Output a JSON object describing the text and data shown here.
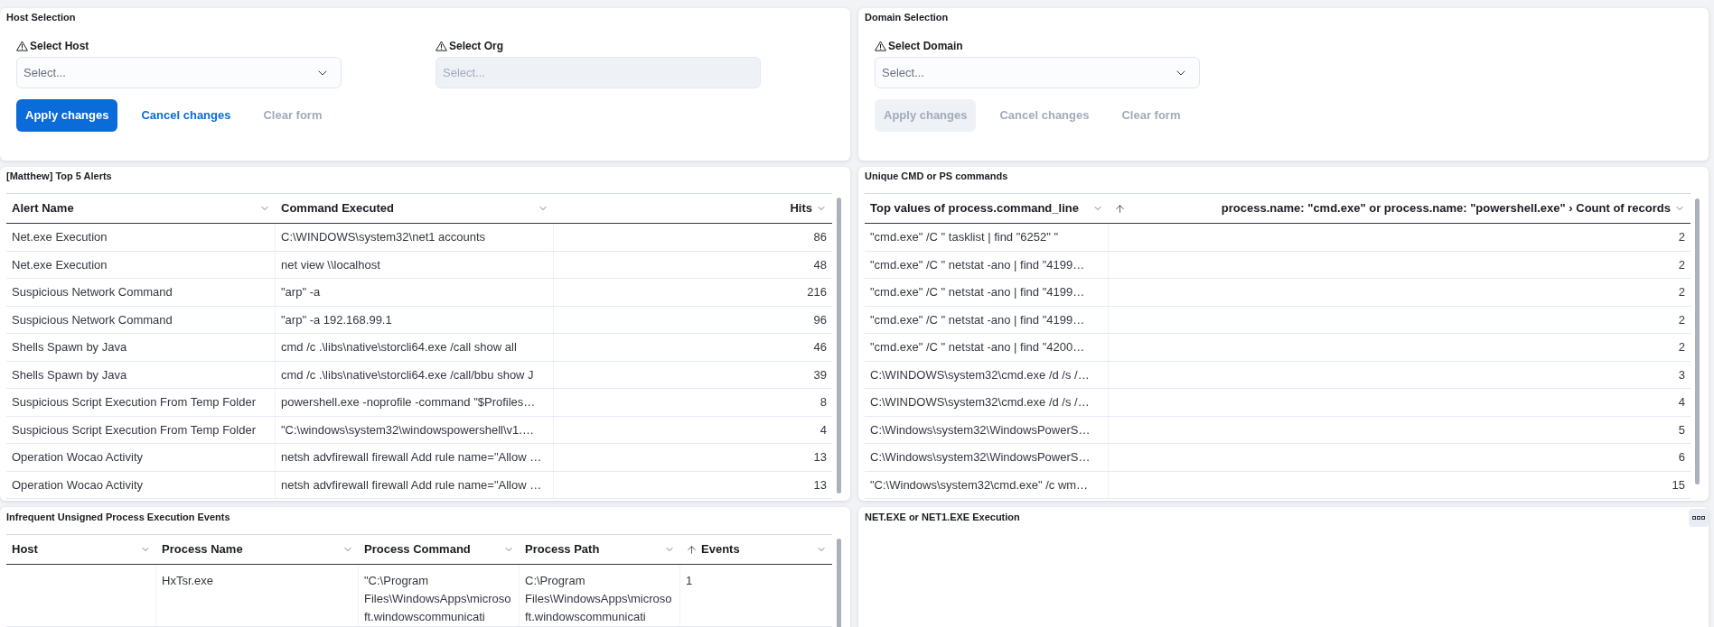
{
  "host_selection": {
    "title": "Host Selection",
    "fields": [
      {
        "label": "Select Host",
        "warning": true,
        "placeholder": "Select...",
        "disabled": false
      },
      {
        "label": "Select Org",
        "warning": true,
        "placeholder": "Select...",
        "disabled": true
      }
    ],
    "buttons": [
      {
        "label": "Apply changes",
        "kind": "fill",
        "disabled": false
      },
      {
        "label": "Cancel changes",
        "kind": "empty",
        "disabled": false
      },
      {
        "label": "Clear form",
        "kind": "empty",
        "disabled": true
      }
    ]
  },
  "domain_selection": {
    "title": "Domain Selection",
    "fields": [
      {
        "label": "Select Domain",
        "warning": true,
        "placeholder": "Select...",
        "disabled": false
      }
    ],
    "buttons": [
      {
        "label": "Apply changes",
        "kind": "fill",
        "disabled": true
      },
      {
        "label": "Cancel changes",
        "kind": "empty",
        "disabled": true
      },
      {
        "label": "Clear form",
        "kind": "empty",
        "disabled": true
      }
    ]
  },
  "top_alerts": {
    "title": "[Matthew] Top 5 Alerts",
    "columns": [
      {
        "label": "Alert Name",
        "sorted": false
      },
      {
        "label": "Command Executed",
        "sorted": false
      },
      {
        "label": "Hits",
        "sorted": false
      }
    ],
    "rows": [
      [
        "Net.exe Execution",
        "C:\\WINDOWS\\system32\\net1 accounts",
        "86"
      ],
      [
        "Net.exe Execution",
        "net view \\\\localhost",
        "48"
      ],
      [
        "Suspicious Network Command",
        "\"arp\" -a",
        "216"
      ],
      [
        "Suspicious Network Command",
        "\"arp\" -a 192.168.99.1",
        "96"
      ],
      [
        "Shells Spawn by Java",
        "cmd /c .\\libs\\native\\storcli64.exe /call show all",
        "46"
      ],
      [
        "Shells Spawn by Java",
        "cmd /c .\\libs\\native\\storcli64.exe /call/bbu show J",
        "39"
      ],
      [
        "Suspicious Script Execution From Temp Folder",
        "powershell.exe -noprofile -command \"$Profiles…",
        "8"
      ],
      [
        "Suspicious Script Execution From Temp Folder",
        "\"C:\\windows\\system32\\windowspowershell\\v1.…",
        "4"
      ],
      [
        "Operation Wocao Activity",
        "netsh advfirewall firewall Add rule name=\"Allow …",
        "13"
      ],
      [
        "Operation Wocao Activity",
        "netsh advfirewall firewall Add rule name=\"Allow …",
        "13"
      ]
    ]
  },
  "unique_commands": {
    "title": "Unique CMD or PS commands",
    "columns": [
      {
        "label": "Top values of process.command_line",
        "sorted": false
      },
      {
        "label": "process.name: \"cmd.exe\" or process.name: \"powershell.exe\" › Count of records",
        "sorted": true
      }
    ],
    "rows": [
      [
        "\"cmd.exe\" /C \" tasklist | find \"6252\" \"",
        "2"
      ],
      [
        "\"cmd.exe\" /C \" netstat -ano | find \"4199…",
        "2"
      ],
      [
        "\"cmd.exe\" /C \" netstat -ano | find \"4199…",
        "2"
      ],
      [
        "\"cmd.exe\" /C \" netstat -ano | find \"4199…",
        "2"
      ],
      [
        "\"cmd.exe\" /C \" netstat -ano | find \"4200…",
        "2"
      ],
      [
        "C:\\WINDOWS\\system32\\cmd.exe /d /s /…",
        "3"
      ],
      [
        "C:\\WINDOWS\\system32\\cmd.exe /d /s /…",
        "4"
      ],
      [
        "C:\\Windows\\system32\\WindowsPowerS…",
        "5"
      ],
      [
        "C:\\Windows\\system32\\WindowsPowerS…",
        "6"
      ],
      [
        "\"C:\\Windows\\system32\\cmd.exe\" /c wm…",
        "15"
      ]
    ]
  },
  "unsigned_process_events": {
    "title": "Infrequent Unsigned Process Execution Events",
    "columns": [
      {
        "label": "Host",
        "sorted": false
      },
      {
        "label": "Process Name",
        "sorted": false
      },
      {
        "label": "Process Command",
        "sorted": false
      },
      {
        "label": "Process Path",
        "sorted": false
      },
      {
        "label": "Events",
        "sorted": true
      }
    ],
    "rows": [
      {
        "process_name": "HxTsr.exe",
        "process_command": "\"C:\\Program Files\\WindowsApps\\microsoft.windowscommunicati",
        "process_path": "C:\\Program Files\\WindowsApps\\microsoft.windowscommunicati",
        "events": "1"
      }
    ]
  },
  "net_exe_execution": {
    "title": "NET.EXE or NET1.EXE Execution"
  }
}
